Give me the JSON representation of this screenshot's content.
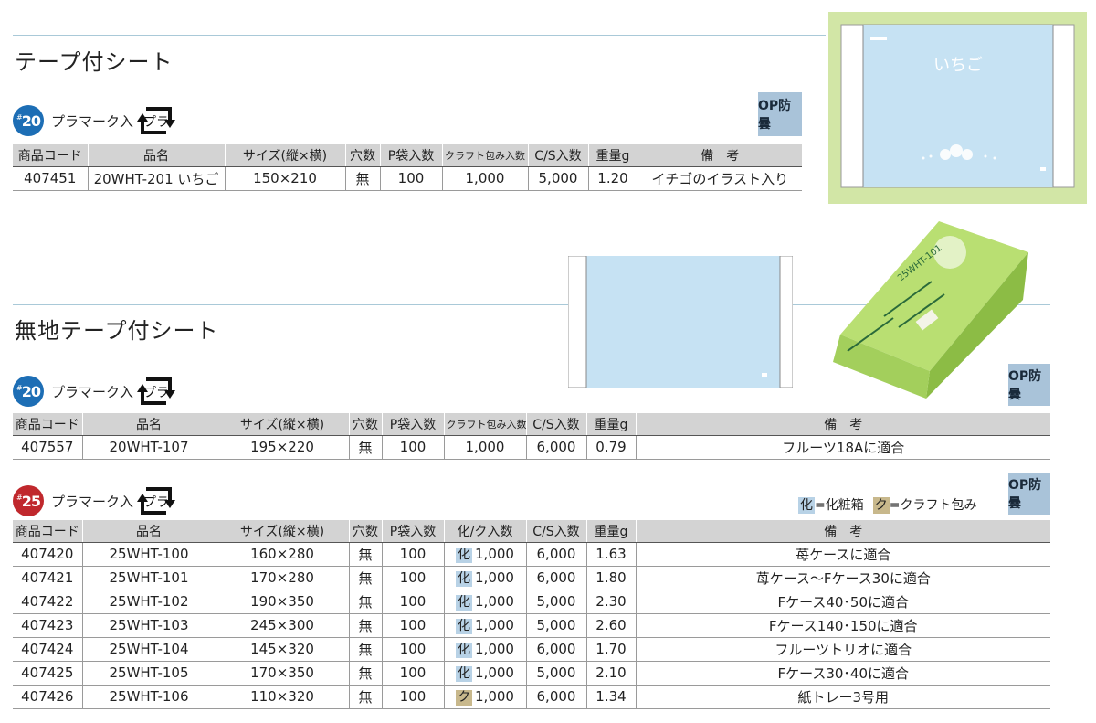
{
  "section1": {
    "title": "テープ付シート",
    "group": {
      "badge": "20",
      "badge_prefix": "#",
      "pla_label": "プラマーク入",
      "op_label": "OP防曇",
      "headers": [
        "商品コード",
        "品名",
        "サイズ(縦×横)",
        "穴数",
        "P袋入数",
        "クラフト包み入数",
        "C/S入数",
        "重量g",
        "備　考"
      ],
      "rows": [
        [
          "407451",
          "20WHT-201 いちご",
          "150×210",
          "無",
          "100",
          "1,000",
          "5,000",
          "1.20",
          "イチゴのイラスト入り"
        ]
      ]
    },
    "image": {
      "label": "いちご",
      "bg": "#cfe3a8"
    }
  },
  "section2": {
    "title": "無地テープ付シート",
    "group1": {
      "badge": "20",
      "badge_prefix": "#",
      "pla_label": "プラマーク入",
      "op_label": "OP防曇",
      "headers": [
        "商品コード",
        "品名",
        "サイズ(縦×横)",
        "穴数",
        "P袋入数",
        "クラフト包み入数",
        "C/S入数",
        "重量g",
        "備　考"
      ],
      "rows": [
        [
          "407557",
          "20WHT-107",
          "195×220",
          "無",
          "100",
          "1,000",
          "6,000",
          "0.79",
          "フルーツ18Aに適合"
        ]
      ]
    },
    "group2": {
      "badge": "25",
      "badge_prefix": "#",
      "pla_label": "プラマーク入",
      "op_label": "OP防曇",
      "legend": {
        "ka_mark": "化",
        "ka_text": "=化粧箱",
        "ku_mark": "ク",
        "ku_text": "=クラフト包み"
      },
      "headers": [
        "商品コード",
        "品名",
        "サイズ(縦×横)",
        "穴数",
        "P袋入数",
        "化/ク入数",
        "C/S入数",
        "重量g",
        "備　考"
      ],
      "rows": [
        {
          "code": "407420",
          "name": "25WHT-100",
          "size": "160×280",
          "holes": "無",
          "p": "100",
          "kind": "化",
          "kind_type": "ka",
          "qty": "1,000",
          "cs": "6,000",
          "weight": "1.63",
          "note": "苺ケースに適合"
        },
        {
          "code": "407421",
          "name": "25WHT-101",
          "size": "170×280",
          "holes": "無",
          "p": "100",
          "kind": "化",
          "kind_type": "ka",
          "qty": "1,000",
          "cs": "6,000",
          "weight": "1.80",
          "note": "苺ケース～Fケース30に適合"
        },
        {
          "code": "407422",
          "name": "25WHT-102",
          "size": "190×350",
          "holes": "無",
          "p": "100",
          "kind": "化",
          "kind_type": "ka",
          "qty": "1,000",
          "cs": "5,000",
          "weight": "2.30",
          "note": "Fケース40･50に適合"
        },
        {
          "code": "407423",
          "name": "25WHT-103",
          "size": "245×300",
          "holes": "無",
          "p": "100",
          "kind": "化",
          "kind_type": "ka",
          "qty": "1,000",
          "cs": "5,000",
          "weight": "2.60",
          "note": "Fケース140･150に適合"
        },
        {
          "code": "407424",
          "name": "25WHT-104",
          "size": "145×320",
          "holes": "無",
          "p": "100",
          "kind": "化",
          "kind_type": "ka",
          "qty": "1,000",
          "cs": "6,000",
          "weight": "1.70",
          "note": "フルーツトリオに適合"
        },
        {
          "code": "407425",
          "name": "25WHT-105",
          "size": "170×350",
          "holes": "無",
          "p": "100",
          "kind": "化",
          "kind_type": "ka",
          "qty": "1,000",
          "cs": "5,000",
          "weight": "2.10",
          "note": "Fケース30･40に適合"
        },
        {
          "code": "407426",
          "name": "25WHT-106",
          "size": "110×320",
          "holes": "無",
          "p": "100",
          "kind": "ク",
          "kind_type": "ku",
          "qty": "1,000",
          "cs": "6,000",
          "weight": "1.34",
          "note": "紙トレー3号用"
        }
      ]
    },
    "box_image": {
      "label": "25WHT-101",
      "color": "#a6d15e"
    }
  }
}
